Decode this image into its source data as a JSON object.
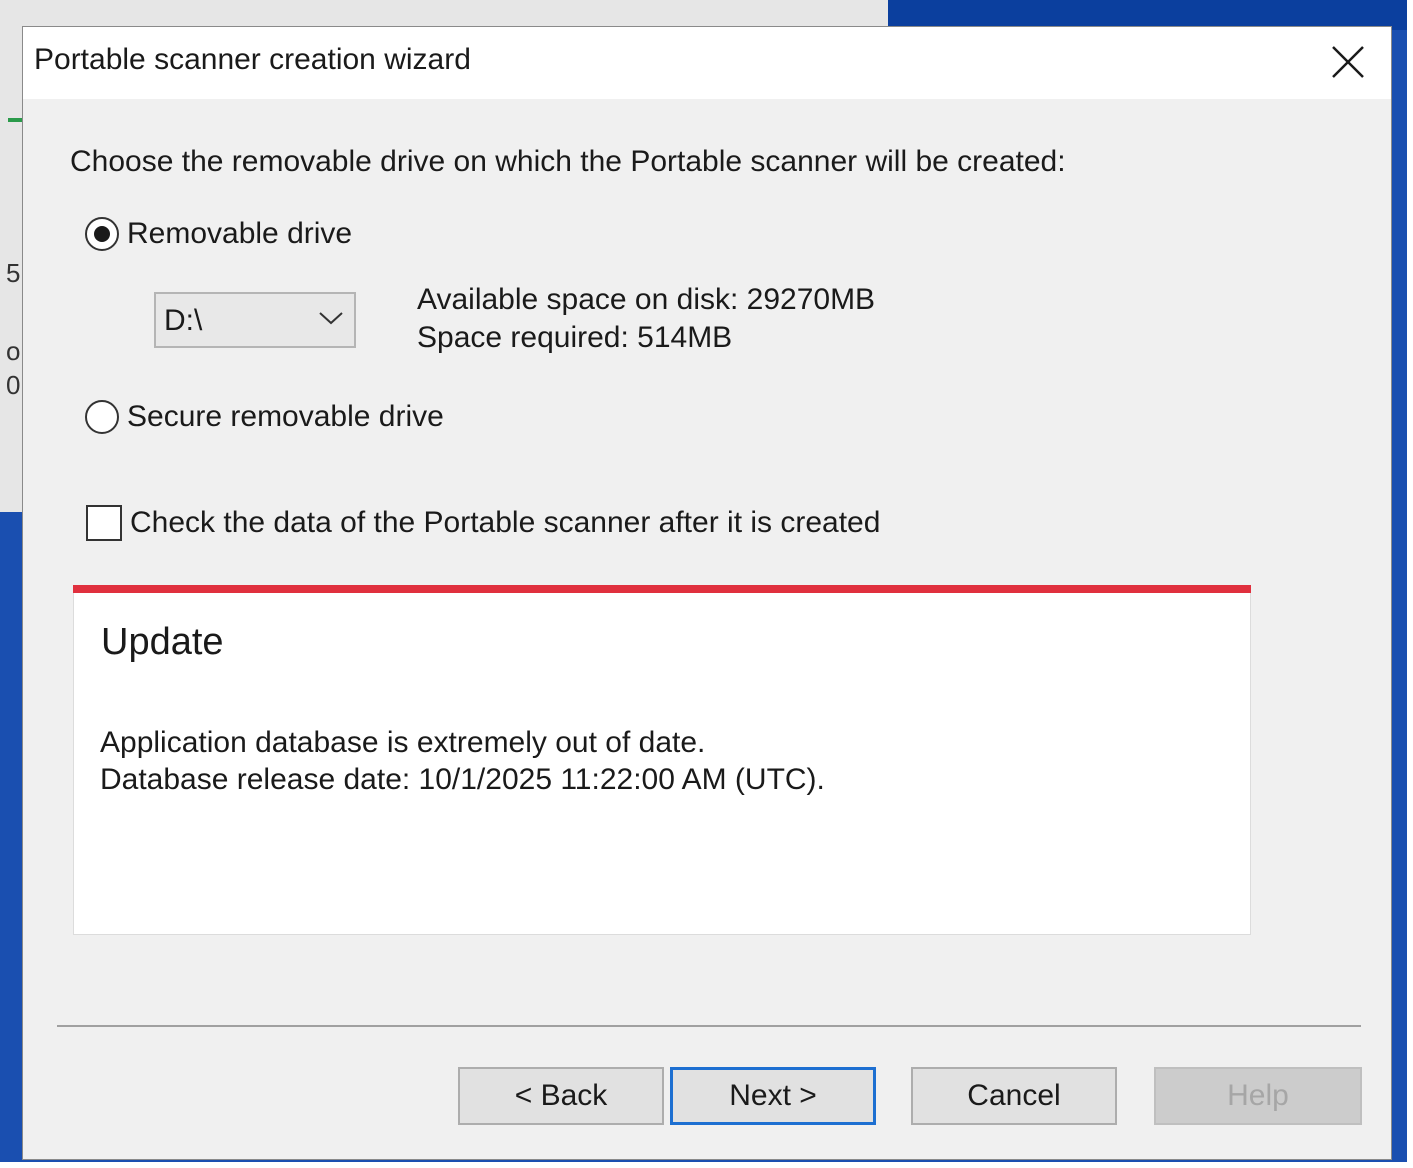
{
  "window": {
    "title": "Portable scanner creation wizard"
  },
  "background": {
    "fragments": [
      "5",
      "o",
      "0"
    ]
  },
  "wizard": {
    "prompt": "Choose the removable drive on which the Portable scanner will be created:",
    "options": [
      {
        "label": "Removable drive",
        "checked": true
      },
      {
        "label": "Secure removable drive",
        "checked": false
      }
    ],
    "drive_select": {
      "value": "D:\\"
    },
    "space_info": {
      "available": "Available space on disk: 29270MB",
      "required": "Space required: 514MB"
    },
    "verify_checkbox": {
      "label": "Check the data of the Portable scanner after it is created",
      "checked": false
    }
  },
  "update": {
    "title": "Update",
    "message_line1": "Application database is extremely out of date.",
    "message_line2": "Database release date: 10/1/2025 11:22:00 AM (UTC).",
    "accent_color": "#e0303e"
  },
  "buttons": {
    "back": "< Back",
    "next": "Next >",
    "cancel": "Cancel",
    "help": "Help"
  },
  "icons": {
    "close": "close-icon",
    "dropdown": "chevron-down-icon"
  }
}
